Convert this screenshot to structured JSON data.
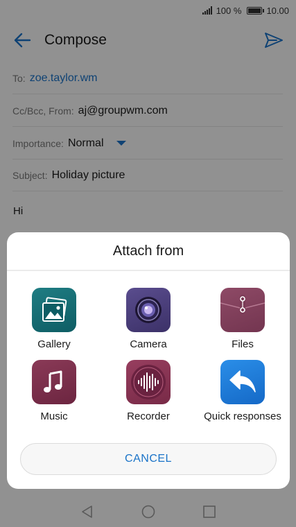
{
  "status_bar": {
    "battery_percent": "100 %",
    "time": "10.00"
  },
  "app_bar": {
    "title": "Compose"
  },
  "compose": {
    "to_label": "To:",
    "to_value": "zoe.taylor.wm",
    "cc_label": "Cc/Bcc, From:",
    "cc_value": "aj@groupwm.com",
    "importance_label": "Importance:",
    "importance_value": "Normal",
    "subject_label": "Subject:",
    "subject_value": "Holiday picture",
    "body": "Hi"
  },
  "attach_sheet": {
    "title": "Attach from",
    "options": [
      {
        "label": "Gallery",
        "icon": "gallery-icon"
      },
      {
        "label": "Camera",
        "icon": "camera-icon"
      },
      {
        "label": "Files",
        "icon": "files-icon"
      },
      {
        "label": "Music",
        "icon": "music-icon"
      },
      {
        "label": "Recorder",
        "icon": "recorder-icon"
      },
      {
        "label": "Quick responses",
        "icon": "quick-responses-icon"
      }
    ],
    "cancel_label": "CANCEL"
  },
  "colors": {
    "accent": "#1a73c8",
    "gallery": "#1f7d83",
    "camera": "#5a4d8e",
    "files": "#8e4a66",
    "music": "#8a3a57",
    "recorder": "#973e5f",
    "quick_responses": "#2a8ee8"
  }
}
